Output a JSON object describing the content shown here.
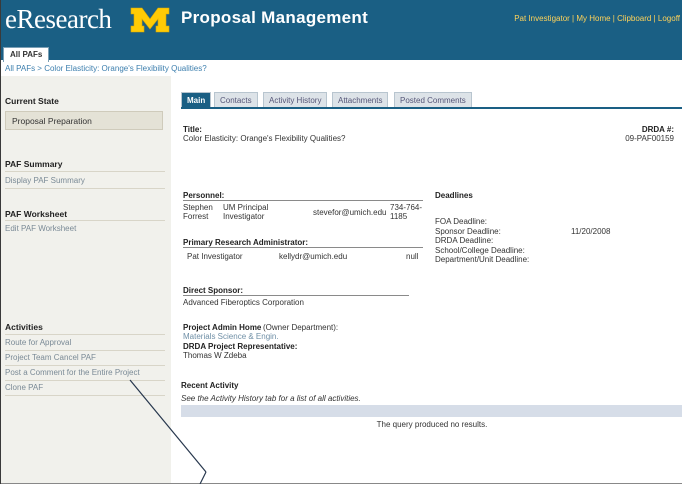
{
  "header": {
    "logo_text": "eResearch",
    "app_title": "Proposal Management",
    "links": [
      "Pat Investigator",
      "My Home",
      "Clipboard",
      "Logoff"
    ],
    "separator": " | "
  },
  "top_tab": {
    "label": "All PAFs"
  },
  "breadcrumb": "All PAFs  >  Color Elasticity: Orange's Flexibility Qualities?",
  "sidebar": {
    "current_state_heading": "Current State",
    "current_state_value": "Proposal Preparation",
    "paf_summary_heading": "PAF Summary",
    "display_paf_summary": "Display PAF Summary",
    "paf_worksheet_heading": "PAF Worksheet",
    "edit_paf_worksheet": "Edit PAF Worksheet",
    "activities_heading": "Activities",
    "activities": [
      "Route for Approval",
      "Project Team Cancel PAF",
      "Post a Comment for the Entire Project",
      "Clone PAF"
    ]
  },
  "main_tabs": [
    "Main",
    "Contacts",
    "Activity History",
    "Attachments",
    "Posted Comments"
  ],
  "main": {
    "title_label": "Title:",
    "title_value": "Color Elasticity: Orange's Flexibility Qualities?",
    "drda_label": "DRDA #:",
    "drda_value": "09-PAF00159",
    "personnel_label": "Personnel:",
    "personnel": {
      "first": "Stephen",
      "last": "Forrest",
      "role1": "UM Principal",
      "role2": "Investigator",
      "email": "stevefor@umich.edu",
      "phone1": "734-764-",
      "phone2": "1185"
    },
    "pra_label": "Primary Research Administrator:",
    "pra": {
      "name": "Pat Investigator",
      "email": "kellydr@umich.edu",
      "phone": "null"
    },
    "deadlines_label": "Deadlines",
    "deadlines": {
      "foa": "FOA Deadline:",
      "sponsor": "Sponsor Deadline:",
      "sponsor_date": "11/20/2008",
      "drda": "DRDA Deadline:",
      "school": "School/College Deadline:",
      "dept": "Department/Unit Deadline:"
    },
    "direct_sponsor_label": "Direct Sponsor:",
    "direct_sponsor_value": "Advanced Fiberoptics Corporation",
    "project_admin_label": "Project Admin Home",
    "project_admin_suffix": "(Owner Department):",
    "project_admin_value": "Materials Science & Engin.",
    "drda_rep_label": "DRDA Project Representative:",
    "drda_rep_value": "Thomas W Zdeba",
    "recent_activity_label": "Recent Activity",
    "recent_activity_note": "See the Activity History tab for a list of all activities.",
    "no_results": "The query produced no results."
  },
  "colors": {
    "header_blue": "#1a5f84",
    "link_yellow": "#ffd35a",
    "sidebar_bg": "#f1f1ec",
    "m_yellow": "#ffcb05"
  }
}
